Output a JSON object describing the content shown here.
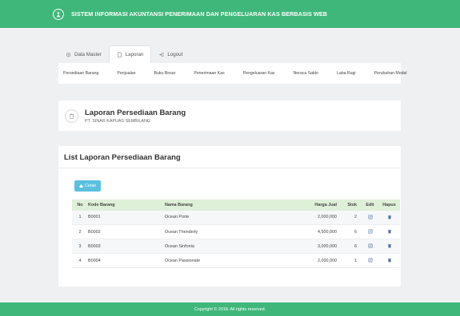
{
  "app": {
    "title": "SISTEM INFORMASI AKUNTANSI PENERIMAAN DAN PENGELUARAN KAS BERBASIS WEB"
  },
  "tabs": [
    {
      "label": "Data Master",
      "icon": "settings-icon"
    },
    {
      "label": "Laporan",
      "icon": "document-icon",
      "active": true
    },
    {
      "label": "Logout",
      "icon": "logout-icon"
    }
  ],
  "subnav": [
    "Persediaan Barang",
    "Penjualan",
    "Buku Besar",
    "Penerimaan Kas",
    "Pengeluaran Kas",
    "Neraca Saldo",
    "Laba Rugi",
    "Perubahan Modal"
  ],
  "report": {
    "title": "Laporan Persediaan Barang",
    "company": "PT. SINAR KAPUAS SEMBILANG"
  },
  "list": {
    "title": "List Laporan Persediaan Barang",
    "print_label": "Cetak",
    "columns": [
      "No",
      "Kode Barang",
      "Nama Barang",
      "Harga Jual",
      "Stok",
      "Edit",
      "Hapus"
    ],
    "rows": [
      {
        "no": "1",
        "kode": "B0001",
        "nama": "Ocean Porte",
        "harga": "2,000,000",
        "stok": "2"
      },
      {
        "no": "2",
        "kode": "B0002",
        "nama": "Ocean Thenderly",
        "harga": "4,500,000",
        "stok": "6"
      },
      {
        "no": "3",
        "kode": "B0003",
        "nama": "Ocean Sinfonia",
        "harga": "3,000,000",
        "stok": "6"
      },
      {
        "no": "4",
        "kode": "B0004",
        "nama": "Ocean Passionate",
        "harga": "2,000,000",
        "stok": "1"
      }
    ]
  },
  "footer": {
    "text": "Copyright © 2018. All rights reserved."
  },
  "colors": {
    "brand_green": "#3fb77a",
    "table_header": "#dff0d8",
    "print_button": "#5bc0de",
    "icon_blue": "#4a6aa5"
  }
}
